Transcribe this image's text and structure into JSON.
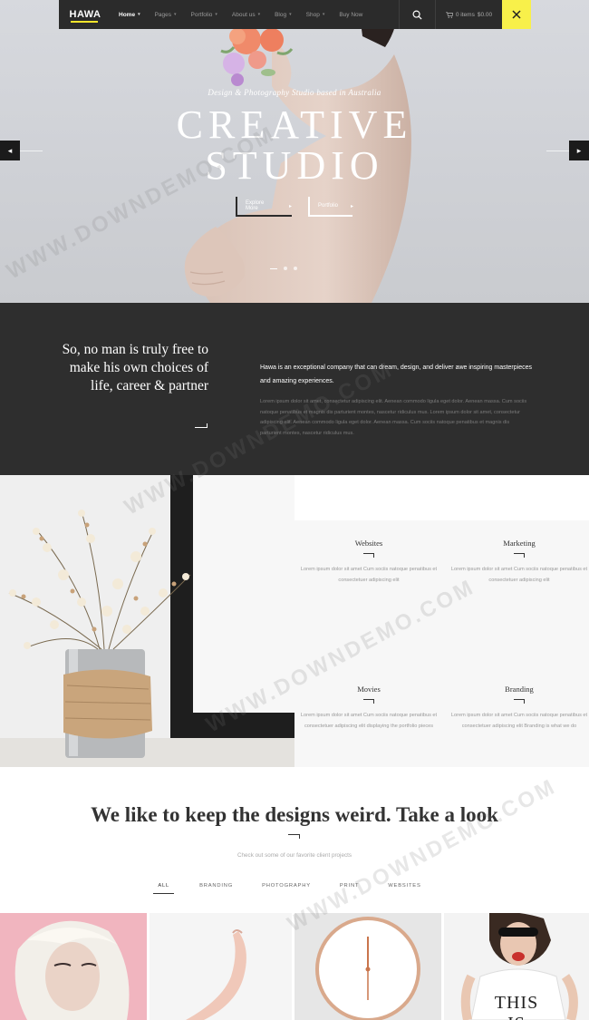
{
  "header": {
    "logo": "HAWA",
    "nav": [
      {
        "label": "Home",
        "active": true,
        "has_menu": true
      },
      {
        "label": "Pages",
        "has_menu": true
      },
      {
        "label": "Portfolio",
        "has_menu": true
      },
      {
        "label": "About us",
        "has_menu": true
      },
      {
        "label": "Blog",
        "has_menu": true
      },
      {
        "label": "Shop",
        "has_menu": true
      },
      {
        "label": "Buy Now",
        "has_menu": false
      }
    ],
    "cart_label": "0 items",
    "cart_total": "$0.00",
    "accent": "#f8f04a"
  },
  "hero": {
    "subtitle": "Design & Photography Studio based in Australia",
    "title_line1": "CREATIVE",
    "title_line2": "STUDIO",
    "button_primary": "Explore More",
    "button_secondary": "Portfolio",
    "slide_count": 3,
    "active_slide": 1
  },
  "about": {
    "quote": "So, no man is truly free to make his own choices of life, career & partner",
    "lead": "Hawa is an exceptional company that can dream, design, and deliver awe inspiring masterpieces and amazing experiences.",
    "body": "Lorem ipsum dolor sit amet, consectetur adipiscing elit. Aenean commodo ligula eget dolor. Aenean massa. Cum sociis natoque penatibus et magnis dis parturient montes, nascetur ridiculus mus. Lorem ipsum dolor sit amet, consectetur adipiscing elit. Aenean commodo ligula eget dolor. Aenean massa. Cum sociis natoque penatibus et magnis dis parturient montes, nascetur ridiculus mus."
  },
  "services": [
    {
      "title": "Websites",
      "text": "Lorem ipsum dolor sit amet Cum sociis natoque penatibus et consectetuer adipiscing elit"
    },
    {
      "title": "Marketing",
      "text": "Lorem ipsum dolor sit amet Cum sociis natoque penatibus et consectetuer adipiscing elit"
    },
    {
      "title": "Movies",
      "text": "Lorem ipsum dolor sit amet Cum sociis natoque penatibus et consectetuer adipiscing elit displaying the portfolio pieces"
    },
    {
      "title": "Branding",
      "text": "Lorem ipsum dolor sit amet Cum sociis natoque penatibus et consectetuer adipiscing elit Branding is what we do"
    }
  ],
  "portfolio": {
    "title": "We like to keep the designs weird. Take a look",
    "subtitle": "Check out some of our favorite client projects",
    "filters": [
      "ALL",
      "BRANDING",
      "PHOTOGRAPHY",
      "PRINT",
      "WEBSITES"
    ],
    "active_filter": "ALL",
    "tile_text": "THIS IS"
  },
  "watermark": "WWW.DOWNDEMO.COM"
}
